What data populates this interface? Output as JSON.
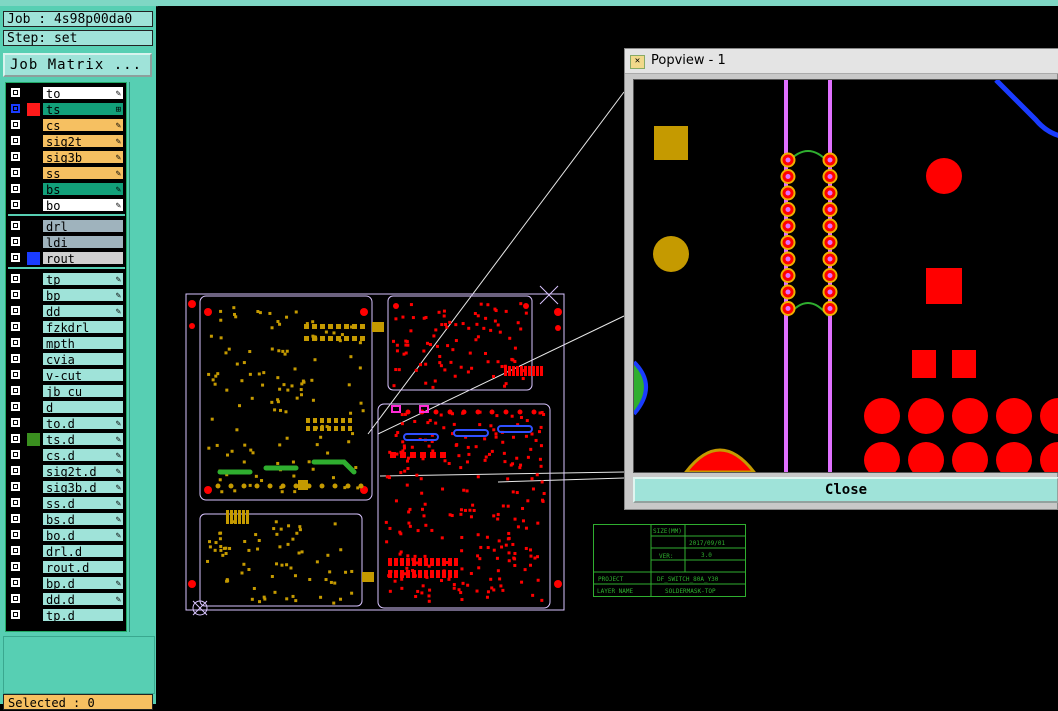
{
  "header": {
    "job": "Job : 4s98p00da0",
    "step": "Step: set"
  },
  "job_matrix_label": "Job Matrix ...",
  "layers_group1": [
    {
      "name": "to",
      "bg": "#ffffff",
      "sq": "",
      "ic": "edit-icon"
    },
    {
      "name": "ts",
      "bg": "#12a07a",
      "sq": "#ff1a1a",
      "ic": "grid-icon",
      "active": true
    },
    {
      "name": "cs",
      "bg": "#f6c061",
      "sq": "",
      "ic": "edit-icon"
    },
    {
      "name": "sig2t",
      "bg": "#f6c061",
      "sq": "",
      "ic": "edit-icon"
    },
    {
      "name": "sig3b",
      "bg": "#f6c061",
      "sq": "",
      "ic": "edit-icon"
    },
    {
      "name": "ss",
      "bg": "#f6c061",
      "sq": "",
      "ic": "edit-icon"
    },
    {
      "name": "bs",
      "bg": "#12a07a",
      "sq": "",
      "ic": "edit-icon"
    },
    {
      "name": "bo",
      "bg": "#ffffff",
      "sq": "",
      "ic": "edit-icon"
    }
  ],
  "layers_group2": [
    {
      "name": "drl",
      "bg": "#9fb3bd",
      "sq": "",
      "ic": ""
    },
    {
      "name": "ldi",
      "bg": "#9fb3bd",
      "sq": "",
      "ic": ""
    },
    {
      "name": "rout",
      "bg": "#d0d0d0",
      "sq": "#1a3cff",
      "ic": ""
    }
  ],
  "layers_group3": [
    {
      "name": "tp",
      "bg": "#9fe3d9",
      "sq": "",
      "ic": "edit-icon"
    },
    {
      "name": "bp",
      "bg": "#9fe3d9",
      "sq": "",
      "ic": "edit-icon"
    },
    {
      "name": "dd",
      "bg": "#9fe3d9",
      "sq": "",
      "ic": "edit-icon"
    },
    {
      "name": "fzkdrl",
      "bg": "#9fe3d9",
      "sq": "",
      "ic": ""
    },
    {
      "name": "mpth",
      "bg": "#9fe3d9",
      "sq": "",
      "ic": ""
    },
    {
      "name": "cvia",
      "bg": "#9fe3d9",
      "sq": "",
      "ic": ""
    },
    {
      "name": "v-cut",
      "bg": "#9fe3d9",
      "sq": "",
      "ic": ""
    },
    {
      "name": "jb_cu",
      "bg": "#9fe3d9",
      "sq": "",
      "ic": ""
    },
    {
      "name": "d",
      "bg": "#9fe3d9",
      "sq": "",
      "ic": ""
    },
    {
      "name": "to.d",
      "bg": "#9fe3d9",
      "sq": "",
      "ic": "edit-icon"
    },
    {
      "name": "ts.d",
      "bg": "#9fe3d9",
      "sq": "#3a8f1f",
      "ic": "edit-icon"
    },
    {
      "name": "cs.d",
      "bg": "#9fe3d9",
      "sq": "",
      "ic": "edit-icon"
    },
    {
      "name": "sig2t.d",
      "bg": "#9fe3d9",
      "sq": "",
      "ic": "edit-icon"
    },
    {
      "name": "sig3b.d",
      "bg": "#9fe3d9",
      "sq": "",
      "ic": "edit-icon"
    },
    {
      "name": "ss.d",
      "bg": "#9fe3d9",
      "sq": "",
      "ic": "edit-icon"
    },
    {
      "name": "bs.d",
      "bg": "#9fe3d9",
      "sq": "",
      "ic": "edit-icon"
    },
    {
      "name": "bo.d",
      "bg": "#9fe3d9",
      "sq": "",
      "ic": "edit-icon"
    },
    {
      "name": "drl.d",
      "bg": "#9fe3d9",
      "sq": "",
      "ic": ""
    },
    {
      "name": "rout.d",
      "bg": "#9fe3d9",
      "sq": "",
      "ic": ""
    },
    {
      "name": "bp.d",
      "bg": "#9fe3d9",
      "sq": "",
      "ic": "edit-icon"
    },
    {
      "name": "dd.d",
      "bg": "#9fe3d9",
      "sq": "",
      "ic": "edit-icon"
    },
    {
      "name": "tp.d",
      "bg": "#9fe3d9",
      "sq": "",
      "ic": ""
    }
  ],
  "selected_label": "Selected : 0",
  "title_block": {
    "size_label": "SIZE(MM)",
    "date": "2017/09/01",
    "ver_label": "VER:",
    "ver": "3.0",
    "project_label": "PROJECT",
    "project": "DF_SWITCH_80A_Y30",
    "layer_label": "LAYER NAME",
    "layer": "SOLDERMASK-TOP"
  },
  "popview": {
    "title": "Popview - 1",
    "close_label": "Close"
  },
  "colors": {
    "pad_red": "#ff0000",
    "outline": "#d9c4ff",
    "gold": "#c59a00",
    "trace_green": "#2fae2f",
    "panel_teal": "#57cfb3"
  }
}
